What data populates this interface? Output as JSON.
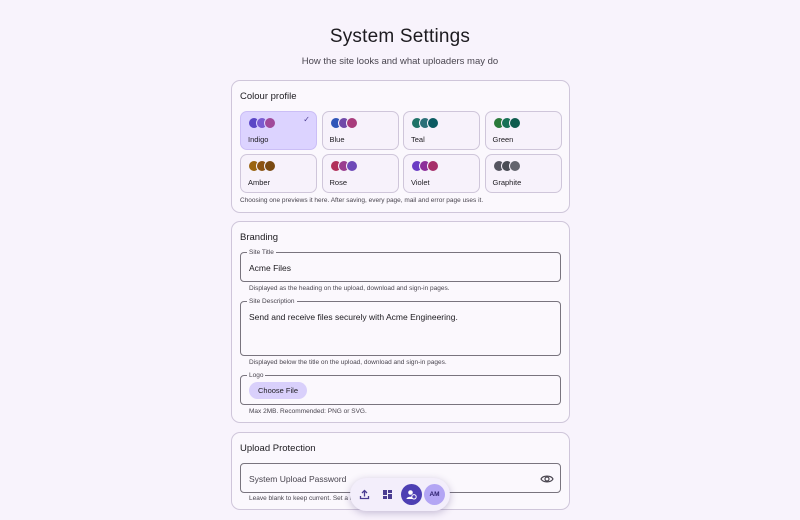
{
  "header": {
    "title": "System Settings",
    "subtitle": "How the site looks and what uploaders may do"
  },
  "colour_profile": {
    "title": "Colour profile",
    "selected": "Indigo",
    "hint": "Choosing one previews it here. After saving, every page, mail and error page uses it.",
    "swatches": [
      {
        "name": "Indigo",
        "colors": [
          "#5a46c6",
          "#7a5bd1",
          "#a0499a"
        ],
        "selected": true
      },
      {
        "name": "Blue",
        "colors": [
          "#2f55b8",
          "#7049a8",
          "#a83c7c"
        ],
        "selected": false
      },
      {
        "name": "Teal",
        "colors": [
          "#1f7368",
          "#2b6f78",
          "#0b5b62"
        ],
        "selected": false
      },
      {
        "name": "Green",
        "colors": [
          "#2a7a3a",
          "#177156",
          "#0e5c4e"
        ],
        "selected": false
      },
      {
        "name": "Amber",
        "colors": [
          "#9a6410",
          "#8b5312",
          "#7a4a12"
        ],
        "selected": false
      },
      {
        "name": "Rose",
        "colors": [
          "#b1305a",
          "#9a3d8f",
          "#6e4ab8"
        ],
        "selected": false
      },
      {
        "name": "Violet",
        "colors": [
          "#6a3cc4",
          "#8d2f9a",
          "#a62f6a"
        ],
        "selected": false
      },
      {
        "name": "Graphite",
        "colors": [
          "#555560",
          "#4a4c55",
          "#63646d"
        ],
        "selected": false
      }
    ]
  },
  "branding": {
    "title": "Branding",
    "site_title_label": "Site Title",
    "site_title_value": "Acme Files",
    "site_title_hint": "Displayed as the heading on the upload, download and sign-in pages.",
    "site_desc_label": "Site Description",
    "site_desc_value": "Send and receive files securely with Acme Engineering.",
    "site_desc_hint": "Displayed below the title on the upload, download and sign-in pages.",
    "logo_label": "Logo",
    "logo_button": "Choose File",
    "logo_hint": "Max 2MB. Recommended: PNG or SVG."
  },
  "upload_protection": {
    "title": "Upload Protection",
    "password_placeholder": "System Upload Password",
    "hint": "Leave blank to keep current. Set a uploading."
  },
  "nav": {
    "avatar_initials": "AM",
    "active": "settings"
  },
  "colors": {
    "accent": "#4d3fb3",
    "selected_swatch_bg": "#dcd3ff",
    "page_bg": "#f8f3fc"
  }
}
